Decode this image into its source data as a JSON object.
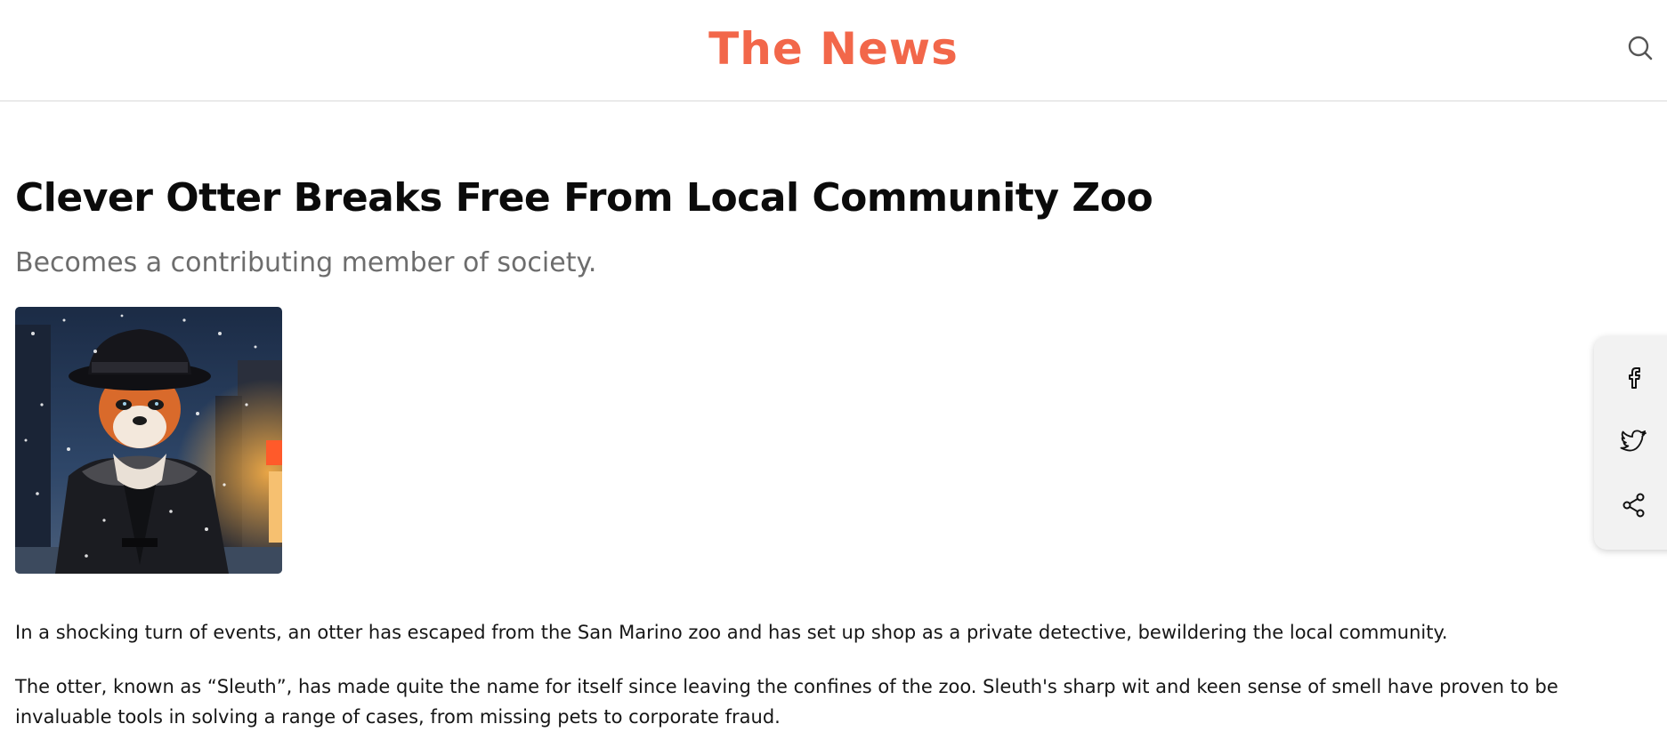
{
  "header": {
    "brand": "The News",
    "search_icon": "search-icon"
  },
  "article": {
    "headline": "Clever Otter Breaks Free From Local Community Zoo",
    "subheadline": "Becomes a contributing member of society.",
    "paragraphs": [
      "In a shocking turn of events, an otter has escaped from the San Marino zoo and has set up shop as a private detective, bewildering the local community.",
      "The otter, known as “Sleuth”, has made quite the name for itself since leaving the confines of the zoo. Sleuth's sharp wit and keen sense of smell have proven to be invaluable tools in solving a range of cases, from missing pets to corporate fraud."
    ]
  },
  "share": {
    "items": [
      {
        "icon": "facebook-icon"
      },
      {
        "icon": "twitter-icon"
      },
      {
        "icon": "share-icon"
      }
    ]
  },
  "colors": {
    "brand": "#f2674a",
    "subhead": "#6d6d6d",
    "panel_bg": "#f2f2f2"
  }
}
